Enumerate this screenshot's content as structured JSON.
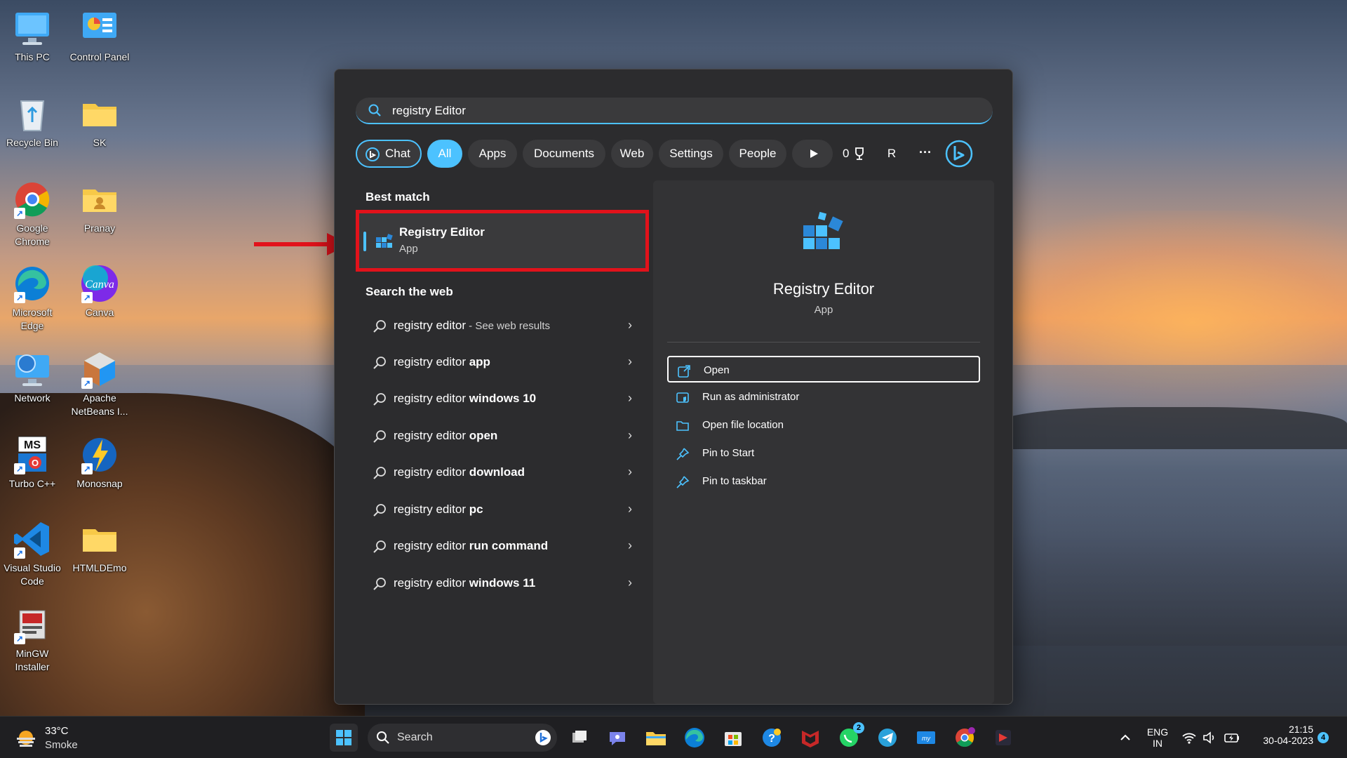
{
  "desktop": {
    "icons": [
      {
        "label": "This PC"
      },
      {
        "label": "Control Panel"
      },
      {
        "label": "Recycle Bin"
      },
      {
        "label": "SK"
      },
      {
        "label": "Google Chrome"
      },
      {
        "label": "Pranay"
      },
      {
        "label": "Microsoft Edge"
      },
      {
        "label": "Canva"
      },
      {
        "label": "Network"
      },
      {
        "label": "Apache NetBeans I..."
      },
      {
        "label": "Turbo C++"
      },
      {
        "label": "Monosnap"
      },
      {
        "label": "Visual Studio Code"
      },
      {
        "label": "HTMLDEmo"
      },
      {
        "label": "MinGW Installer"
      }
    ]
  },
  "search": {
    "query": "registry Editor",
    "filters": [
      {
        "label": "Chat"
      },
      {
        "label": "All"
      },
      {
        "label": "Apps"
      },
      {
        "label": "Documents"
      },
      {
        "label": "Web"
      },
      {
        "label": "Settings"
      },
      {
        "label": "People"
      }
    ],
    "rewards_points": "0",
    "profile_initial": "R",
    "more_label": "···",
    "best_match": {
      "heading": "Best match",
      "name": "Registry Editor",
      "type": "App"
    },
    "web": {
      "heading": "Search the web",
      "results": [
        {
          "prefix": "registry editor",
          "bold": "",
          "hint": " - See web results"
        },
        {
          "prefix": "registry editor ",
          "bold": "app",
          "hint": ""
        },
        {
          "prefix": "registry editor ",
          "bold": "windows 10",
          "hint": ""
        },
        {
          "prefix": "registry editor ",
          "bold": "open",
          "hint": ""
        },
        {
          "prefix": "registry editor ",
          "bold": "download",
          "hint": ""
        },
        {
          "prefix": "registry editor ",
          "bold": "pc",
          "hint": ""
        },
        {
          "prefix": "registry editor ",
          "bold": "run command",
          "hint": ""
        },
        {
          "prefix": "registry editor ",
          "bold": "windows 11",
          "hint": ""
        }
      ]
    },
    "details": {
      "name": "Registry Editor",
      "type": "App",
      "actions": [
        {
          "label": "Open",
          "icon": "open-icon"
        },
        {
          "label": "Run as administrator",
          "icon": "shield-icon"
        },
        {
          "label": "Open file location",
          "icon": "folder-icon"
        },
        {
          "label": "Pin to Start",
          "icon": "pin-icon"
        },
        {
          "label": "Pin to taskbar",
          "icon": "pin-icon"
        }
      ]
    }
  },
  "taskbar": {
    "weather": {
      "temp": "33°C",
      "condition": "Smoke"
    },
    "search_label": "Search",
    "whatsapp_badge": "2",
    "language": {
      "line1": "ENG",
      "line2": "IN"
    },
    "clock": {
      "time": "21:15",
      "date": "30-04-2023"
    },
    "notification_count": "4",
    "accent": "#4cc2ff"
  }
}
